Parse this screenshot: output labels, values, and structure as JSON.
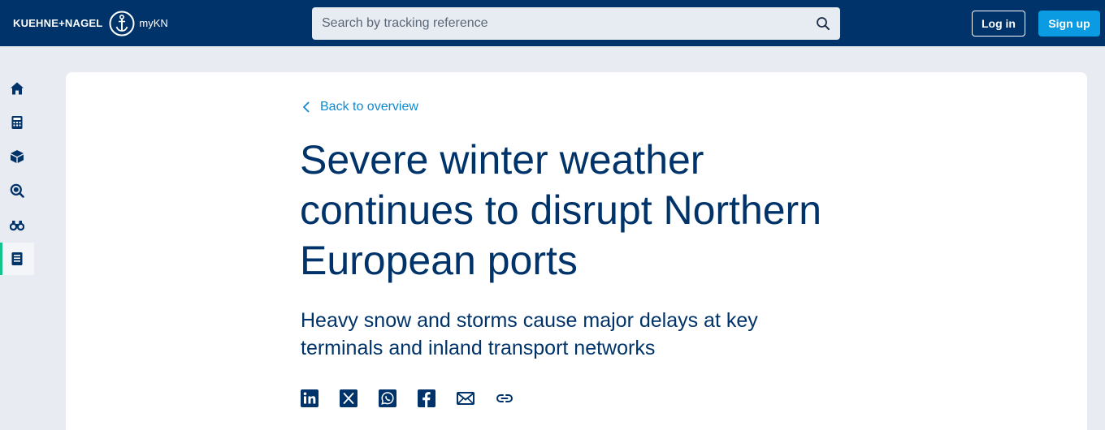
{
  "header": {
    "brand_name": "KUEHNE+NAGEL",
    "brand_sub": "myKN",
    "logo_icon": "anchor-icon",
    "search": {
      "placeholder": "Search by tracking reference",
      "value": "",
      "icon": "search-icon"
    },
    "login_label": "Log in",
    "signup_label": "Sign up"
  },
  "sidebar": {
    "items": [
      {
        "icon": "home-icon",
        "active": false
      },
      {
        "icon": "calculator-icon",
        "active": false
      },
      {
        "icon": "box-icon",
        "active": false
      },
      {
        "icon": "track-search-icon",
        "active": false
      },
      {
        "icon": "binoculars-icon",
        "active": false
      },
      {
        "icon": "news-icon",
        "active": true
      }
    ]
  },
  "article": {
    "back_label": "Back to overview",
    "title": "Severe winter weather continues to disrupt Northern European ports",
    "subtitle": "Heavy snow and storms cause major delays at key terminals and inland transport networks",
    "share": [
      "linkedin-icon",
      "x-icon",
      "whatsapp-icon",
      "facebook-icon",
      "email-icon",
      "link-icon"
    ]
  },
  "colors": {
    "navy": "#003369",
    "accent_blue": "#0b9be3",
    "link_blue": "#0b8ad4",
    "active_green": "#12c58a",
    "page_bg": "#e8ebf1"
  }
}
